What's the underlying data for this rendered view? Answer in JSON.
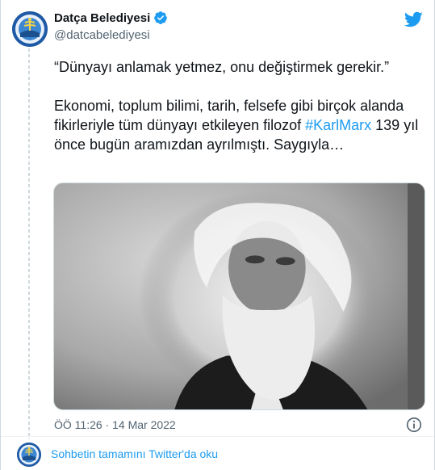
{
  "author": {
    "display_name": "Datça Belediyesi",
    "handle": "@datcabelediyesi",
    "verified": true,
    "avatar_icon": "municipality-seal-icon"
  },
  "tweet": {
    "quote": "“Dünyayı anlamak yetmez, onu değiştirmek gerekir.”",
    "body_before": "Ekonomi, toplum bilimi, tarih, felsefe gibi birçok alanda fikirleriyle tüm dünyayı etkileyen filozof ",
    "hashtag": "#KarlMarx",
    "body_after": " 139 yıl önce bugün aramızdan ayrılmıştı. Saygıyla…",
    "timestamp": "ÖÖ 11:26 · 14 Mar 2022"
  },
  "media": {
    "kind": "black-and-white portrait photo"
  },
  "footer": {
    "read_more": "Sohbetin tamamını Twitter'da oku"
  },
  "colors": {
    "link": "#1d9bf0",
    "text": "#0f1419",
    "muted": "#536471",
    "border": "#cfd9de"
  },
  "icons": [
    "twitter-bird-icon",
    "verified-badge-icon",
    "info-icon"
  ]
}
